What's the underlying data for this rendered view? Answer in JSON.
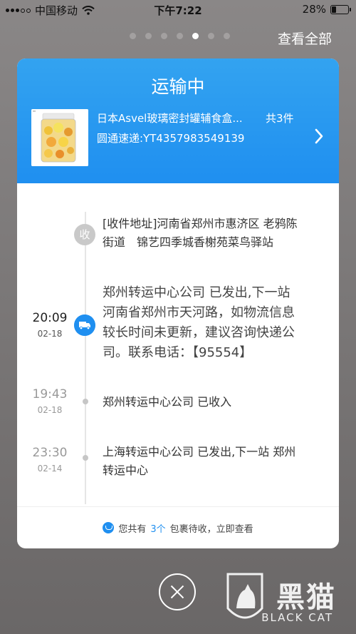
{
  "status_bar": {
    "carrier": "中国移动",
    "time": "下午7:22",
    "battery": "28%",
    "battery_level": 0.28
  },
  "pager": {
    "total": 7,
    "active_index": 4
  },
  "header": {
    "view_all": "查看全部"
  },
  "card": {
    "status": "运输中",
    "product": {
      "name": "日本Asvel玻璃密封罐辅食盒...",
      "count": "共3件",
      "tracking": "圆通速递:YT4357983549139"
    },
    "events": [
      {
        "time": "",
        "date": "",
        "lines": [
          "[收件地址]河南省郑州市惠济区 老鸦陈",
          "街道　锦艺四季城香榭苑菜鸟驿站"
        ],
        "icon": "收"
      },
      {
        "time": "20:09",
        "date": "02-18",
        "lines": [
          "郑州转运中心公司 已发出,下一站",
          "河南省郑州市天河路，如物流信息",
          "较长时间未更新，建议咨询快递公",
          "司。联系电话：【95554】"
        ]
      },
      {
        "time": "19:43",
        "date": "02-18",
        "lines": [
          "郑州转运中心公司 已收入"
        ]
      },
      {
        "time": "23:30",
        "date": "02-14",
        "lines": [
          "上海转运中心公司 已发出,下一站 郑州",
          "转运中心"
        ]
      }
    ],
    "footer": {
      "prefix": "您共有",
      "count": "3个",
      "suffix": "包裹待收，立即查看"
    }
  },
  "watermark": {
    "zh": "黑猫",
    "en": "BLACK CAT"
  },
  "colors": {
    "accent": "#1f8ff0",
    "header_top": "#33a3f0"
  }
}
